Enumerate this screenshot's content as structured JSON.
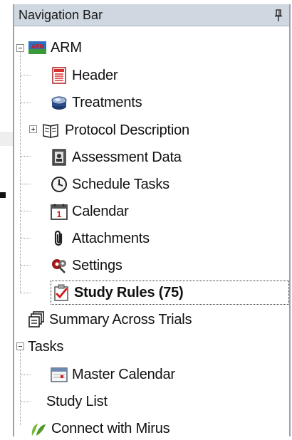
{
  "panel": {
    "title": "Navigation Bar",
    "pin_icon": "pin-icon"
  },
  "tree": {
    "root_label": "ARM",
    "root_icon": "arm-logo-icon",
    "items": [
      {
        "label": "Header",
        "icon": "header-icon"
      },
      {
        "label": "Treatments",
        "icon": "treatments-icon"
      },
      {
        "label": "Protocol Description",
        "icon": "book-icon"
      },
      {
        "label": "Assessment Data",
        "icon": "assessment-data-icon"
      },
      {
        "label": "Schedule Tasks",
        "icon": "clock-icon"
      },
      {
        "label": "Calendar",
        "icon": "calendar-icon"
      },
      {
        "label": "Attachments",
        "icon": "paperclip-icon"
      },
      {
        "label": "Settings",
        "icon": "settings-icon"
      },
      {
        "label": "Study Rules (75)",
        "icon": "clipboard-check-icon",
        "selected": true
      }
    ],
    "summary_label": "Summary Across Trials",
    "summary_icon": "summary-icon",
    "tasks_label": "Tasks",
    "tasks_items": [
      {
        "label": "Master Calendar",
        "icon": "master-calendar-icon"
      },
      {
        "label": "Study List",
        "icon": ""
      }
    ],
    "mirus_label": "Connect with Mirus",
    "mirus_icon": "leaf-icon"
  }
}
